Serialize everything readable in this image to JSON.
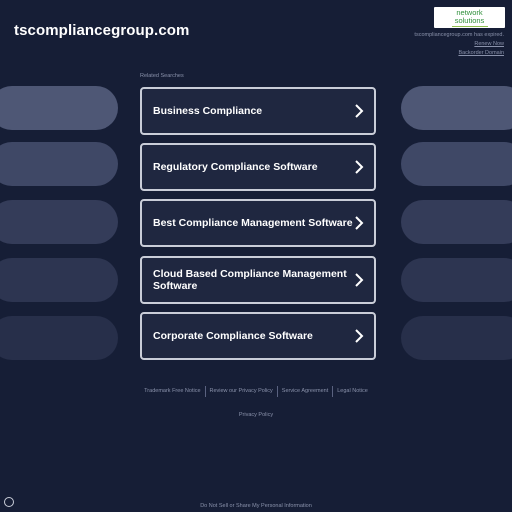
{
  "header": {
    "domain": "tscompliancegroup.com",
    "logo": {
      "line1": "network",
      "line2": "solutions",
      "brand_color": "#2f8f3a"
    },
    "expiry_text": "tscompliancegroup.com has expired.",
    "renew_link": "Renew Now",
    "backorder_link": "Backorder Domain"
  },
  "related_label": "Related Searches",
  "cards": [
    {
      "label": "Business Compliance"
    },
    {
      "label": "Regulatory Compliance Software"
    },
    {
      "label": "Best Compliance Management Software"
    },
    {
      "label": "Cloud Based Compliance Management Software"
    },
    {
      "label": "Corporate Compliance Software"
    }
  ],
  "footer": {
    "links": [
      "Trademark Free Notice",
      "Review our Privacy Policy",
      "Service Agreement",
      "Legal Notice"
    ],
    "privacy_policy": "Privacy Policy",
    "do_not_sell": "Do Not Sell or Share My Personal Information"
  },
  "colors": {
    "background": "#161e36",
    "card_border": "#c9cdd8",
    "ghost": "#4e5775"
  }
}
